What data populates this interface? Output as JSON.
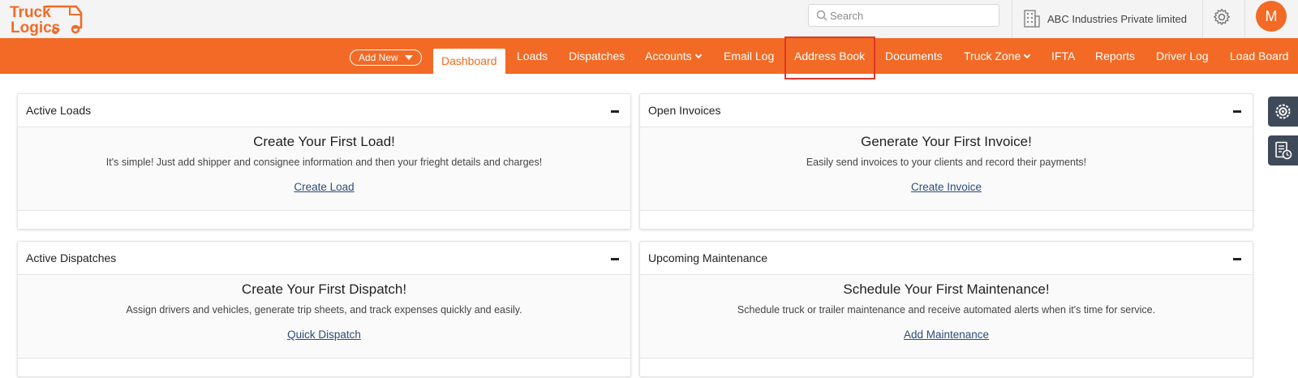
{
  "header": {
    "logo": {
      "line1": "Truck",
      "line2": "Logics"
    },
    "search": {
      "placeholder": "Search",
      "icon": "search-icon"
    },
    "company": {
      "name": "ABC Industries Private limited",
      "icon": "building-icon"
    },
    "settings_icon": "gear-icon",
    "avatar": {
      "initial": "M"
    }
  },
  "nav": {
    "add_new": "Add New",
    "items": [
      {
        "label": "Dashboard",
        "active": true
      },
      {
        "label": "Loads"
      },
      {
        "label": "Dispatches"
      },
      {
        "label": "Accounts",
        "dropdown": true
      },
      {
        "label": "Email Log"
      },
      {
        "label": "Address Book",
        "highlighted": true
      },
      {
        "label": "Documents"
      },
      {
        "label": "Truck Zone",
        "dropdown": true
      },
      {
        "label": "IFTA"
      },
      {
        "label": "Reports"
      },
      {
        "label": "Driver Log"
      },
      {
        "label": "Load Board"
      }
    ]
  },
  "cards": [
    {
      "title": "Active Loads",
      "heading": "Create Your First Load!",
      "description": "It's simple! Just add shipper and consignee information and then your frieght details and charges!",
      "link": "Create Load"
    },
    {
      "title": "Open Invoices",
      "heading": "Generate Your First Invoice!",
      "description": "Easily send invoices to your clients and record their payments!",
      "link": "Create Invoice"
    },
    {
      "title": "Active Dispatches",
      "heading": "Create Your First Dispatch!",
      "description": "Assign drivers and vehicles, generate trip sheets, and track expenses quickly and easily.",
      "link": "Quick Dispatch"
    },
    {
      "title": "Upcoming Maintenance",
      "heading": "Schedule Your First Maintenance!",
      "description": "Schedule truck or trailer maintenance and receive automated alerts when it's time for service.",
      "link": "Add Maintenance"
    }
  ],
  "side_buttons": [
    {
      "icon": "widget-settings-icon"
    },
    {
      "icon": "report-clock-icon"
    }
  ],
  "colors": {
    "brand": "#f26a25",
    "nav_text": "#ffffff",
    "link": "#2a4d7a",
    "highlight": "#e0362b",
    "side_button": "#3e4959"
  }
}
